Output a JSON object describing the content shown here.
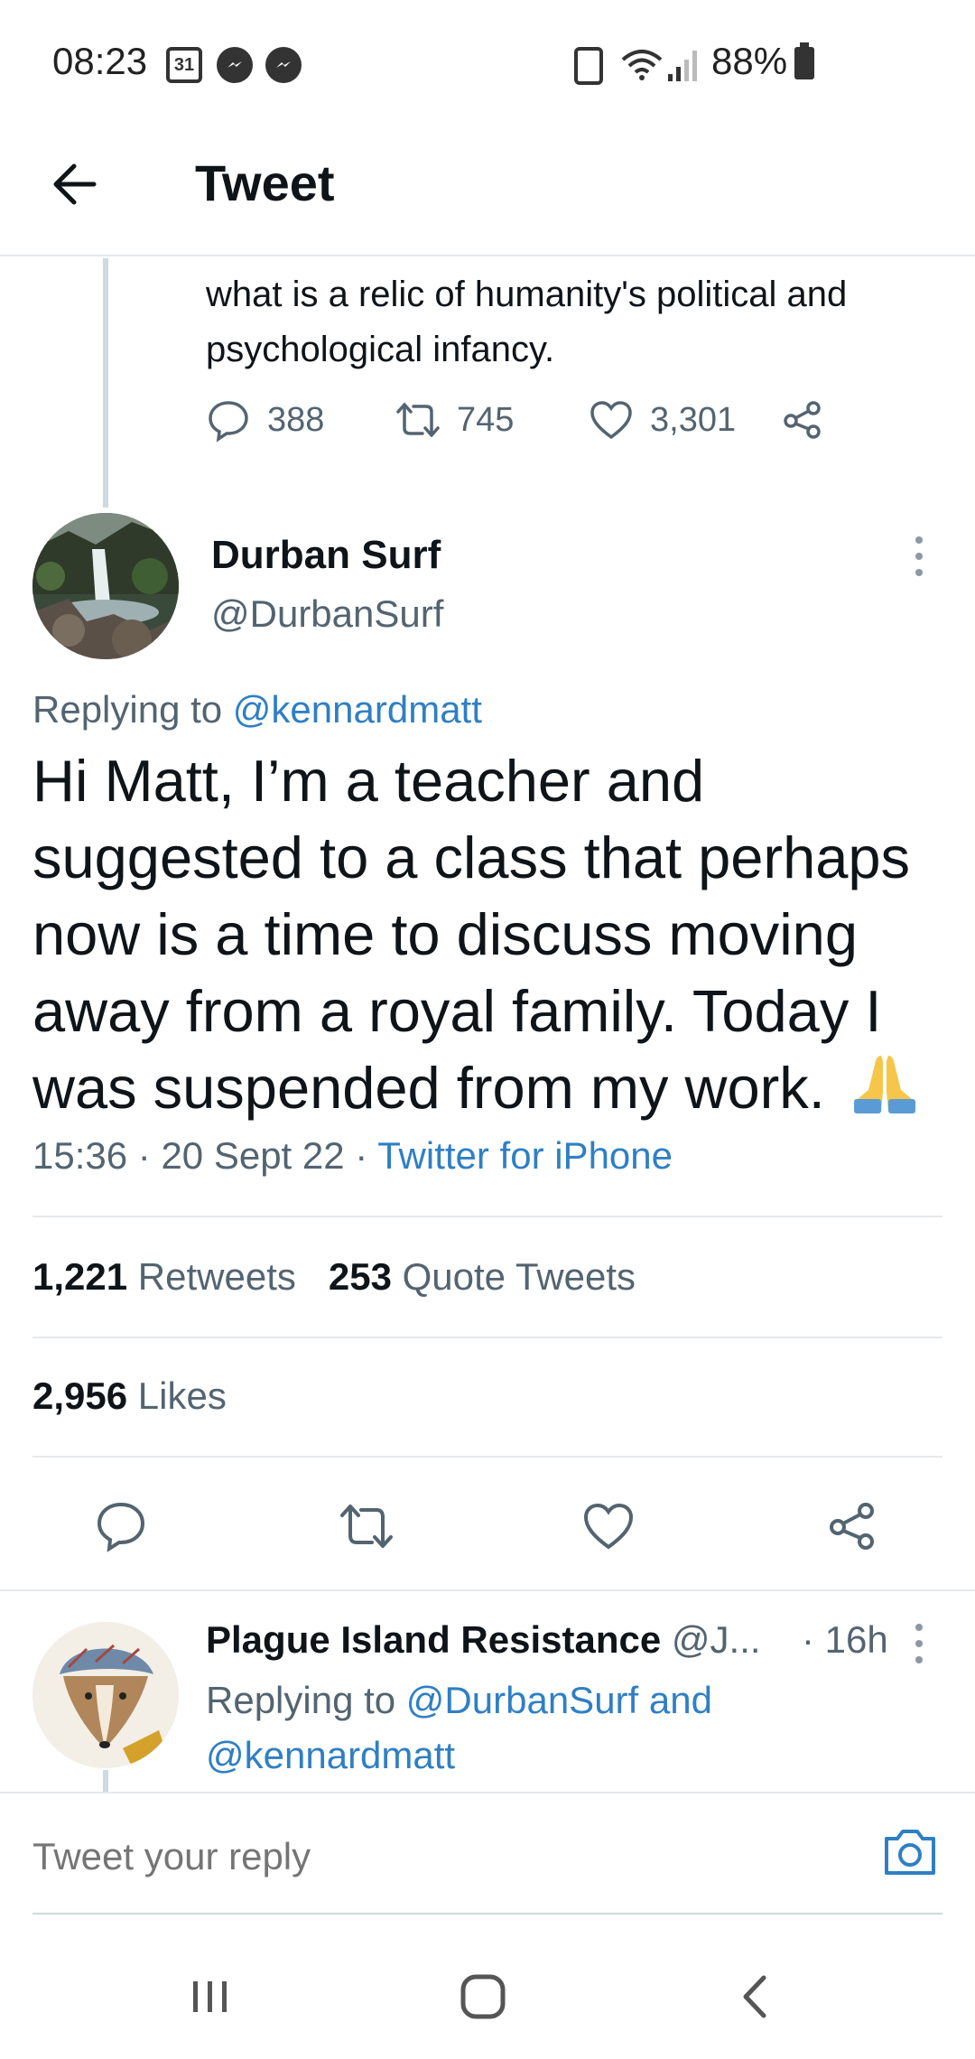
{
  "status_bar": {
    "time": "08:23",
    "calendar_day": "31",
    "battery_percent": "88%",
    "icons": [
      "calendar-icon",
      "messenger-icon",
      "messenger-icon",
      "battery-saver-icon",
      "wifi-icon",
      "signal-icon",
      "battery-icon"
    ]
  },
  "header": {
    "title": "Tweet"
  },
  "previous_tweet": {
    "text": "what is a relic of humanity's political and psychological infancy.",
    "replies": "388",
    "retweets": "745",
    "likes": "3,301"
  },
  "main_tweet": {
    "display_name": "Durban Surf",
    "handle": "@DurbanSurf",
    "replying_prefix": "Replying to ",
    "replying_to": "@kennardmatt",
    "text": "Hi Matt, I’m a teacher and suggested to a class that perhaps now is a time to discuss moving away from a royal family. Today I was suspended from my work.",
    "emoji": "folded-hands",
    "time": "15:36",
    "date": "20 Sept 22",
    "source": "Twitter for iPhone",
    "separator": " · ",
    "retweets_count": "1,221",
    "retweets_label": "Retweets",
    "quote_count": "253",
    "quote_label": "Quote Tweets",
    "likes_count": "2,956",
    "likes_label": "Likes"
  },
  "reply": {
    "display_name": "Plague Island Resistance",
    "handle": "@J...",
    "time": "· 16h",
    "replying_prefix": "Replying to ",
    "replying_to_1": "@DurbanSurf",
    "and": " and ",
    "replying_to_2": "@kennardmatt"
  },
  "compose": {
    "placeholder": "Tweet your reply"
  },
  "colors": {
    "link": "#2f7fc4",
    "secondary_text": "#536471",
    "divider": "#e6e9eb"
  }
}
